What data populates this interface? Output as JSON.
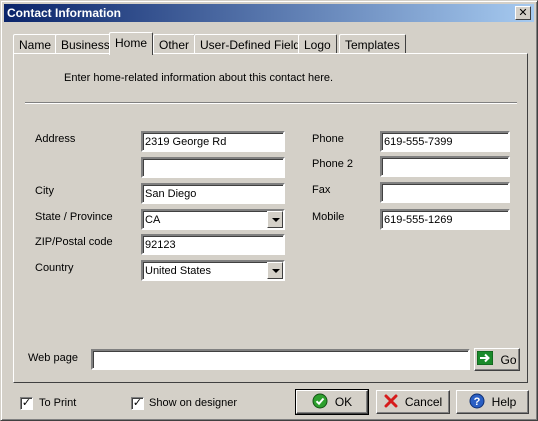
{
  "window": {
    "title": "Contact Information",
    "close_glyph": "✕"
  },
  "tabs": [
    {
      "label": "Name"
    },
    {
      "label": "Business"
    },
    {
      "label": "Home",
      "active": true
    },
    {
      "label": "Other"
    },
    {
      "label": "User-Defined Fields"
    },
    {
      "label": "Logo"
    },
    {
      "label": "Templates"
    }
  ],
  "intro": "Enter home-related information about this contact here.",
  "fields": {
    "address_label": "Address",
    "address_line1": "2319 George Rd",
    "address_line2": "",
    "city_label": "City",
    "city": "San Diego",
    "state_label": "State / Province",
    "state": "CA",
    "zip_label": "ZIP/Postal code",
    "zip": "92123",
    "country_label": "Country",
    "country": "United States",
    "phone_label": "Phone",
    "phone": "619-555-7399",
    "phone2_label": "Phone 2",
    "phone2": "",
    "fax_label": "Fax",
    "fax": "",
    "mobile_label": "Mobile",
    "mobile": "619-555-1269",
    "webpage_label": "Web page",
    "webpage": ""
  },
  "buttons": {
    "go": "Go",
    "ok": "OK",
    "cancel": "Cancel",
    "help": "Help"
  },
  "footer": {
    "to_print_label": "To Print",
    "to_print_checked": true,
    "show_designer_label": "Show on designer",
    "show_designer_checked": true
  },
  "icons": {
    "ok": "check-circle-icon",
    "cancel": "red-x-icon",
    "help": "question-circle-icon",
    "go": "green-arrow-icon"
  }
}
